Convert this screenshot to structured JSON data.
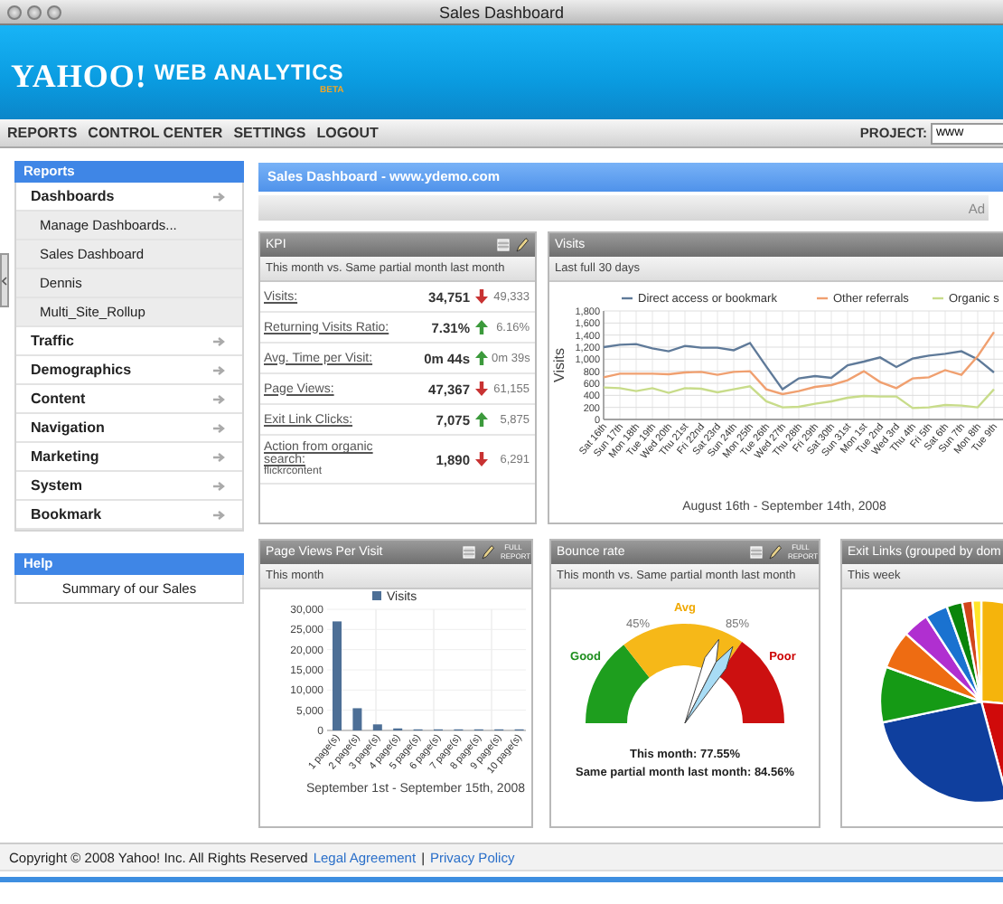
{
  "window": {
    "title": "Sales Dashboard"
  },
  "header": {
    "logo": "YAHOO!",
    "product": "WEB ANALYTICS",
    "badge": "BETA"
  },
  "nav": {
    "items": [
      "REPORTS",
      "CONTROL CENTER",
      "SETTINGS",
      "LOGOUT"
    ],
    "project_label": "PROJECT:",
    "project_value": "www"
  },
  "sidebar": {
    "title": "Reports",
    "items": [
      {
        "label": "Dashboards",
        "children": [
          {
            "label": "Manage Dashboards..."
          },
          {
            "label": "Sales Dashboard"
          },
          {
            "label": "Dennis"
          },
          {
            "label": "Multi_Site_Rollup"
          }
        ]
      },
      {
        "label": "Traffic"
      },
      {
        "label": "Demographics"
      },
      {
        "label": "Content"
      },
      {
        "label": "Navigation"
      },
      {
        "label": "Marketing"
      },
      {
        "label": "System"
      },
      {
        "label": "Bookmark"
      }
    ],
    "help_title": "Help",
    "help_link": "Summary of our Sales"
  },
  "dashboard": {
    "title": "Sales Dashboard - www.ydemo.com",
    "toolbar_text": "Ad"
  },
  "kpi": {
    "title": "KPI",
    "toolbar": true,
    "subtitle": "This month vs. Same partial month last month",
    "rows": [
      {
        "metric": "Visits:",
        "value": "34,751",
        "increased": false,
        "previous": "49,333"
      },
      {
        "metric": "Returning Visits Ratio:",
        "value": "7.31%",
        "increased": true,
        "previous": "6.16%"
      },
      {
        "metric": "Avg. Time per Visit:",
        "value": "0m 44s",
        "increased": true,
        "previous": "0m 39s"
      },
      {
        "metric": "Page Views:",
        "value": "47,367",
        "increased": false,
        "previous": "61,155"
      },
      {
        "metric": "Exit Link Clicks:",
        "value": "7,075",
        "increased": true,
        "previous": "5,875"
      },
      {
        "metric": "Action from organic search:",
        "note": "flickrcontent",
        "value": "1,890",
        "increased": false,
        "previous": "6,291"
      }
    ]
  },
  "visits": {
    "title": "Visits",
    "subtitle": "Last full 30 days",
    "chart_data": {
      "type": "line",
      "grid": true,
      "legend": "top",
      "xlabel": "August 16th - September 14th, 2008",
      "ylabel": "Visits",
      "categories": [
        "Sat 16th",
        "Sun 17th",
        "Mon 18th",
        "Tue 19th",
        "Wed 20th",
        "Thu 21st",
        "Fri 22nd",
        "Sat 23rd",
        "Sun 24th",
        "Mon 25th",
        "Tue 26th",
        "Wed 27th",
        "Thu 28th",
        "Fri 29th",
        "Sat 30th",
        "Sun 31st",
        "Mon 1st",
        "Tue 2nd",
        "Wed 3rd",
        "Thu 4th",
        "Fri 5th",
        "Sat 6th",
        "Sun 7th",
        "Mon 8th",
        "Tue 9th"
      ],
      "series": [
        {
          "name": "Direct access or bookmark",
          "color": "#5f7a99",
          "values": [
            1200,
            1240,
            1250,
            1180,
            1130,
            1220,
            1190,
            1190,
            1150,
            1270,
            880,
            500,
            680,
            720,
            690,
            900,
            960,
            1030,
            870,
            1010,
            1060,
            1090,
            1130,
            1000,
            780
          ]
        },
        {
          "name": "Other referrals",
          "color": "#f0a070",
          "values": [
            700,
            760,
            760,
            760,
            750,
            780,
            790,
            740,
            790,
            800,
            500,
            420,
            470,
            540,
            570,
            650,
            800,
            620,
            520,
            680,
            700,
            820,
            740,
            1050,
            1450
          ]
        },
        {
          "name": "Organic s",
          "color": "#c8dc8a",
          "values": [
            530,
            520,
            470,
            520,
            440,
            520,
            510,
            450,
            500,
            550,
            300,
            200,
            210,
            260,
            300,
            360,
            390,
            380,
            380,
            190,
            200,
            240,
            230,
            200,
            500
          ]
        }
      ],
      "ylim": [
        0,
        1800
      ],
      "yticks": [
        0,
        200,
        400,
        600,
        800,
        {
          "value": 1000,
          "label": "1,000"
        },
        {
          "value": 1200,
          "label": "1,200"
        },
        {
          "value": 1400,
          "label": "1,400"
        },
        {
          "value": 1600,
          "label": "1,600"
        },
        {
          "value": 1800,
          "label": "1,800"
        }
      ]
    }
  },
  "page_views": {
    "title": "Page Views Per Visit",
    "toolbar": true,
    "full_report": "FULL REPORT",
    "subtitle": "This month",
    "chart_data": {
      "type": "bar",
      "grid": true,
      "legend": "top",
      "xlabel": "September 1st - September 15th, 2008",
      "categories": [
        "1 page(s)",
        "2 page(s)",
        "3 page(s)",
        "4 page(s)",
        "5 page(s)",
        "6 page(s)",
        "7 page(s)",
        "8 page(s)",
        "9 page(s)",
        "10 page(s)"
      ],
      "series": [
        {
          "name": "Visits",
          "color": "#4d6f96",
          "values": [
            27000,
            5500,
            1500,
            500,
            0,
            0,
            0,
            0,
            0,
            0
          ]
        }
      ],
      "ylim": [
        0,
        30000
      ],
      "yticks": [
        0,
        {
          "value": 5000,
          "label": "5,000"
        },
        {
          "value": 10000,
          "label": "10,000"
        },
        {
          "value": 15000,
          "label": "15,000"
        },
        {
          "value": 20000,
          "label": "20,000"
        },
        {
          "value": 25000,
          "label": "25,000"
        },
        {
          "value": 30000,
          "label": "30,000"
        }
      ]
    }
  },
  "bounce": {
    "title": "Bounce rate",
    "toolbar": true,
    "full_report": "FULL REPORT",
    "subtitle": "This month vs. Same partial month last month",
    "good": "Good",
    "avg": "Avg",
    "poor": "Poor",
    "low": "45%",
    "high": "85%",
    "this_month": "This month: 77.55%",
    "last_month": "Same partial month last month: 84.56%"
  },
  "exit_links": {
    "title": "Exit Links (grouped by dom",
    "subtitle": "This week"
  },
  "footer": {
    "copyright": "Copyright © 2008 Yahoo! Inc. All Rights Reserved",
    "links": [
      "Legal Agreement",
      "Privacy Policy"
    ],
    "separator": "|"
  }
}
